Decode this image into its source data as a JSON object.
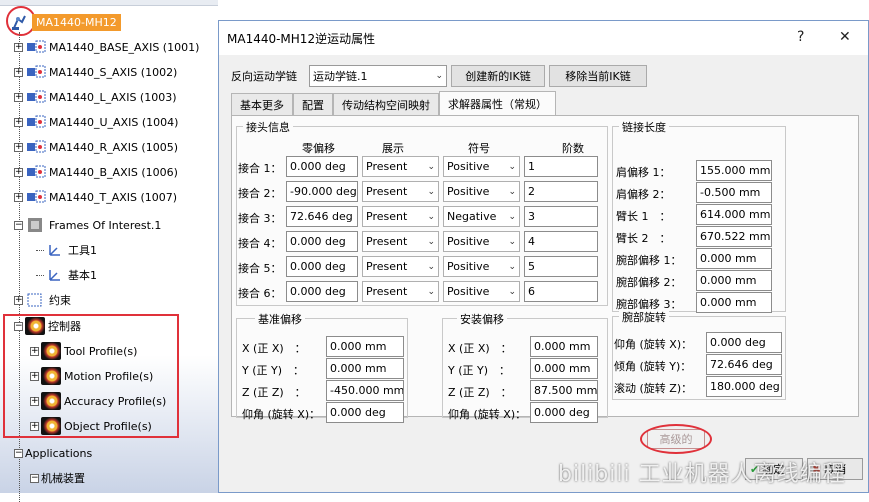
{
  "tree": {
    "root_label": "MA1440-MH12",
    "axes": [
      "MA1440_BASE_AXIS (1001)",
      "MA1440_S_AXIS (1002)",
      "MA1440_L_AXIS (1003)",
      "MA1440_U_AXIS (1004)",
      "MA1440_R_AXIS (1005)",
      "MA1440_B_AXIS (1006)",
      "MA1440_T_AXIS (1007)"
    ],
    "frames_label": "Frames Of Interest.1",
    "frames_children": [
      "工具1",
      "基本1"
    ],
    "constraint_label": "约束",
    "controller_label": "控制器",
    "controller_children": [
      "Tool Profile(s)",
      "Motion Profile(s)",
      "Accuracy Profile(s)",
      "Object Profile(s)"
    ],
    "applications_label": "Applications",
    "mech_label": "机械装置"
  },
  "dialog": {
    "title": "MA1440-MH12逆运动属性",
    "help_label": "?",
    "close_label": "✕",
    "ik_label": "反向运动学链",
    "ik_value": "运动学链.1",
    "create_button": "创建新的IK链",
    "remove_button": "移除当前IK链",
    "tabs": [
      "基本更多",
      "配置",
      "传动结构空间映射",
      "求解器属性（常规）"
    ],
    "joint_group": {
      "title": "接头信息",
      "headers": [
        "零偏移",
        "展示",
        "符号",
        "阶数"
      ],
      "rows": [
        {
          "label": "接合 1：",
          "offset": "0.000 deg",
          "show": "Present",
          "sign": "Positive",
          "order": "1"
        },
        {
          "label": "接合 2：",
          "offset": "-90.000 deg",
          "show": "Present",
          "sign": "Positive",
          "order": "2"
        },
        {
          "label": "接合 3：",
          "offset": "72.646 deg",
          "show": "Present",
          "sign": "Negative",
          "order": "3"
        },
        {
          "label": "接合 4：",
          "offset": "0.000 deg",
          "show": "Present",
          "sign": "Positive",
          "order": "4"
        },
        {
          "label": "接合 5：",
          "offset": "0.000 deg",
          "show": "Present",
          "sign": "Positive",
          "order": "5"
        },
        {
          "label": "接合 6：",
          "offset": "0.000 deg",
          "show": "Present",
          "sign": "Positive",
          "order": "6"
        }
      ]
    },
    "link_group": {
      "title": "链接长度",
      "rows": [
        {
          "label": "肩偏移 1：",
          "value": "155.000 mm"
        },
        {
          "label": "肩偏移 2：",
          "value": "-0.500 mm"
        },
        {
          "label": "臂长 1　：",
          "value": "614.000 mm"
        },
        {
          "label": "臂长 2　：",
          "value": "670.522 mm"
        },
        {
          "label": "腕部偏移 1：",
          "value": "0.000 mm"
        },
        {
          "label": "腕部偏移 2：",
          "value": "0.000 mm"
        },
        {
          "label": "腕部偏移 3：",
          "value": "0.000 mm"
        }
      ]
    },
    "base_group": {
      "title": "基准偏移",
      "rows": [
        {
          "label": "X (正 X)　：",
          "value": "0.000 mm"
        },
        {
          "label": "Y (正 Y)　：",
          "value": "0.000 mm"
        },
        {
          "label": "Z (正 Z)　：",
          "value": "-450.000 mm"
        },
        {
          "label": "仰角 (旋转 X)：",
          "value": "0.000 deg"
        }
      ]
    },
    "mount_group": {
      "title": "安装偏移",
      "rows": [
        {
          "label": "X (正 X)　：",
          "value": "0.000 mm"
        },
        {
          "label": "Y (正 Y)　：",
          "value": "0.000 mm"
        },
        {
          "label": "Z (正 Z)　：",
          "value": "87.500 mm"
        },
        {
          "label": "仰角 (旋转 X)：",
          "value": "0.000 deg"
        }
      ]
    },
    "wrist_group": {
      "title": "腕部旋转",
      "rows": [
        {
          "label": "仰角 (旋转 X)：",
          "value": "0.000 deg"
        },
        {
          "label": "倾角 (旋转 Y)：",
          "value": "72.646 deg"
        },
        {
          "label": "滚动 (旋转 Z)：",
          "value": "180.000 deg"
        }
      ]
    },
    "advanced_button": "高级的",
    "ok_button": "确定",
    "cancel_button": "取消"
  },
  "watermark": "bilibili 工业机器人离线编程",
  "colors": {
    "accent_red": "#e0313a",
    "root_highlight": "#f39a2c",
    "dialog_bg": "#f0f0f0"
  }
}
